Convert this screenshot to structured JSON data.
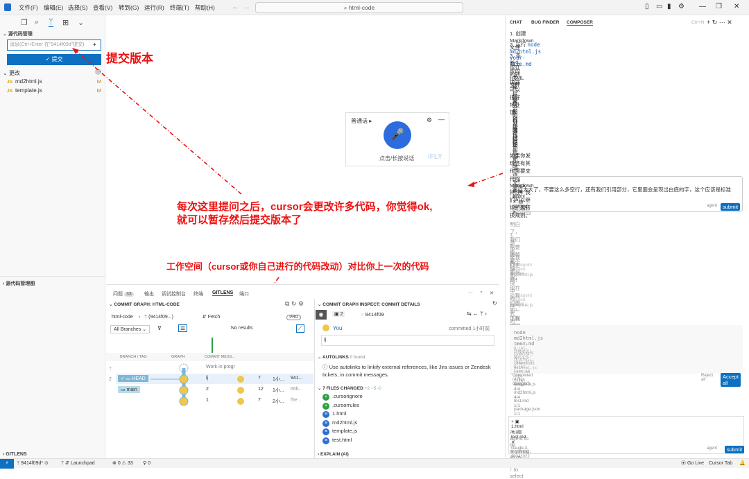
{
  "menu": [
    "文件(F)",
    "编辑(E)",
    "选择(S)",
    "查看(V)",
    "转到(G)",
    "运行(R)",
    "终端(T)",
    "帮助(H)"
  ],
  "search_title": "html-code",
  "sidebar": {
    "scm_title": "源代码管理",
    "commit_placeholder": "消息(Ctrl+Enter 在\"9414f09d\"提交)",
    "commit_label": "✓ 提交",
    "changes_label": "更改",
    "files": [
      {
        "name": "md2html.js",
        "status": "M"
      },
      {
        "name": "template.js",
        "status": "M"
      }
    ],
    "graph_title": "源代码管理图",
    "gitlens": "GITLENS"
  },
  "speech": {
    "mode": "普通话",
    "hint": "点击/长按说话",
    "logo": "iFLY"
  },
  "annotations": {
    "commit": "提交版本",
    "ask_line1": "每次这里提问之后，cursor会更改许多代码，你觉得ok,",
    "ask_line2": "就可以暂存然后提交版本了",
    "workspace": "工作空间（cursor或你自己进行的代码改动）对比你上一次的代码"
  },
  "panel": {
    "tabs": [
      "问题",
      "输出",
      "调试控制台",
      "终端",
      "GITLENS",
      "端口"
    ],
    "problems_count": "33",
    "graph_title": "COMMIT GRAPH: HTML-CODE",
    "repo": "html-code",
    "branch_ref": "(9414f09...)",
    "fetch": "Fetch",
    "pro": "PRO",
    "all_branches": "All Branches",
    "no_results": "No results",
    "headers": [
      "BRANCH / TAG",
      "GRAPH",
      "COMMIT MESS..."
    ],
    "rows": [
      {
        "branch": "",
        "msg": "Work in progr",
        "files": "",
        "time": "",
        "sha": ""
      },
      {
        "branch": "HEAD",
        "msg": "ij",
        "files": "7",
        "time": "1小...",
        "sha": "941..."
      },
      {
        "branch": "main",
        "msg": "2",
        "files": "12",
        "time": "1小...",
        "sha": "66b..."
      },
      {
        "branch": "",
        "msg": "1",
        "files": "7",
        "time": "2小...",
        "sha": "f5e..."
      }
    ],
    "side_nums": [
      "2",
      "0",
      "0",
      "0"
    ]
  },
  "inspect": {
    "title": "COMMIT GRAPH INSPECT: COMMIT DETAILS",
    "sha": "9414f09",
    "count": "2",
    "author": "You",
    "time": "committed 1小时前",
    "message": "ij",
    "autolinks": "AUTOLINKS",
    "found": "0 found",
    "autolinks_text": "Use autolinks to linkify external references, like Jira issues or Zendesk tickets, in commit messages.",
    "files_changed": "7 FILES CHANGED",
    "diffstat": "+2 ~5 -0",
    "files": [
      {
        "name": ".cursorignore",
        "kind": "add"
      },
      {
        "name": ".cursorrules",
        "kind": "add"
      },
      {
        "name": "1.html",
        "kind": "mod"
      },
      {
        "name": "md2html.js",
        "kind": "mod"
      },
      {
        "name": "template.js",
        "kind": "mod"
      },
      {
        "name": "test.html",
        "kind": "mod"
      }
    ],
    "explain": "EXPLAIN (AI)"
  },
  "chat": {
    "tabs": [
      "CHAT",
      "BUG FINDER",
      "COMPOSER"
    ],
    "shortcut": "Ctrl+N",
    "lines": [
      "1. 创建 Markdown 文件",
      "2. 运行 node md2html.js your-file.md",
      "3. 查看生成的 HTML 文件",
      "现在的转换器可以很好地处理："
    ],
    "bullets": [
      "多级标题",
      "代码块和行内代码",
      "复杂的列表结构",
      "引用块",
      "分隔线",
      "链接和图片",
      "加粗和强调文本"
    ],
    "tail": "如果你发现还有其他需要支持的 Markdown 特性，我们可以继续扩展转换规则。",
    "input_tags": [
      "Image",
      "1.html",
      "test.md"
    ],
    "input_text": "空行太大了，不要这么多空行，还有我们引用部分，它里面会呈现出白底的字，这个应该是标准的：",
    "model": "claude-3-5-sonnet-20241022",
    "agent": "agent",
    "submit": "submit",
    "reply1": "明白了，我们需要调整两个地方：",
    "reply2": "1. 减少空行",
    "reply3": "2. 修复引用块中的样式问题",
    "reply4": "让我们更新代码：",
    "checkpoint": "Checkpoint created. restore",
    "file_md2html": "md2html.js 4/4",
    "reply5": "现在让我们更新一下样式定义：",
    "checkpoint2": "Checkpoint created. restore",
    "file_template": "template.js 1/1",
    "reply6": "让我们测试一下更新后的转换器：",
    "cmd": "node md2html.js test.md",
    "term1": "(base) D:\\AI-Code\\AI写作\\html-code>node md2html.js test.md",
    "term2": "转换成功！输出文件: test.html",
    "term3": "(base) D:\\AI-Code\\AI写作\\html-code>",
    "completed": "Completed (4 files changed)",
    "reject": "Reject all",
    "accept": "Accept all",
    "changed_files": [
      "template.js 4/4",
      "md2html.js 4/4",
      "test.md 1/1",
      "package.json 1/1"
    ],
    "bottom_tags": [
      "1.html",
      "test.md"
    ],
    "bottom_placeholder": "Ask agent to do anything, @ to mention, ↑ to select",
    "model2": "claude-3-5-sonnet-20241022"
  },
  "status": {
    "branch": "9414f09d*",
    "launchpad": "Launchpad",
    "errors": "0",
    "warnings": "33",
    "ports": "0",
    "golive": "Go Live",
    "cursortab": "Cursor Tab"
  },
  "colors": {
    "accent": "#0e70c0",
    "annotation": "#ee1111"
  }
}
